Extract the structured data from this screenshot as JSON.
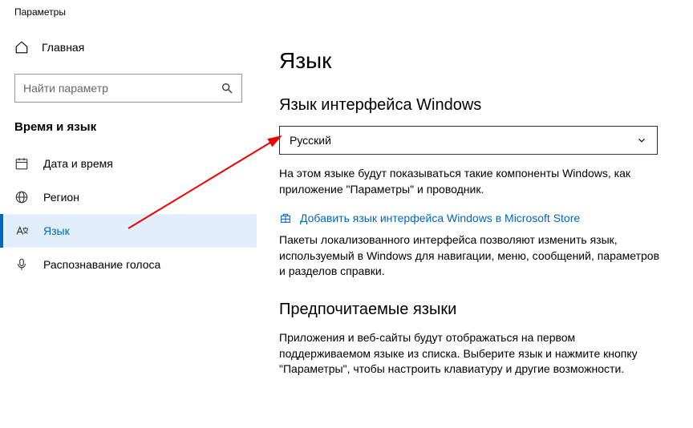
{
  "window_title": "Параметры",
  "sidebar": {
    "home_label": "Главная",
    "search_placeholder": "Найти параметр",
    "category_label": "Время и язык",
    "items": [
      {
        "label": "Дата и время"
      },
      {
        "label": "Регион"
      },
      {
        "label": "Язык"
      },
      {
        "label": "Распознавание голоса"
      }
    ]
  },
  "content": {
    "page_title": "Язык",
    "section1_title": "Язык интерфейса Windows",
    "dropdown_value": "Русский",
    "section1_desc": "На этом языке будут показываться такие компоненты Windows, как приложение \"Параметры\" и проводник.",
    "store_link": "Добавить язык интерфейса Windows в Microsoft Store",
    "section1_desc2": "Пакеты локализованного интерфейса позволяют изменить язык, используемый в Windows для навигации, меню, сообщений, параметров и разделов справки.",
    "section2_title": "Предпочитаемые языки",
    "section2_desc": "Приложения и веб-сайты будут отображаться на первом поддерживаемом языке из списка. Выберите язык и нажмите кнопку \"Параметры\", чтобы настроить клавиатуру и другие возможности."
  }
}
